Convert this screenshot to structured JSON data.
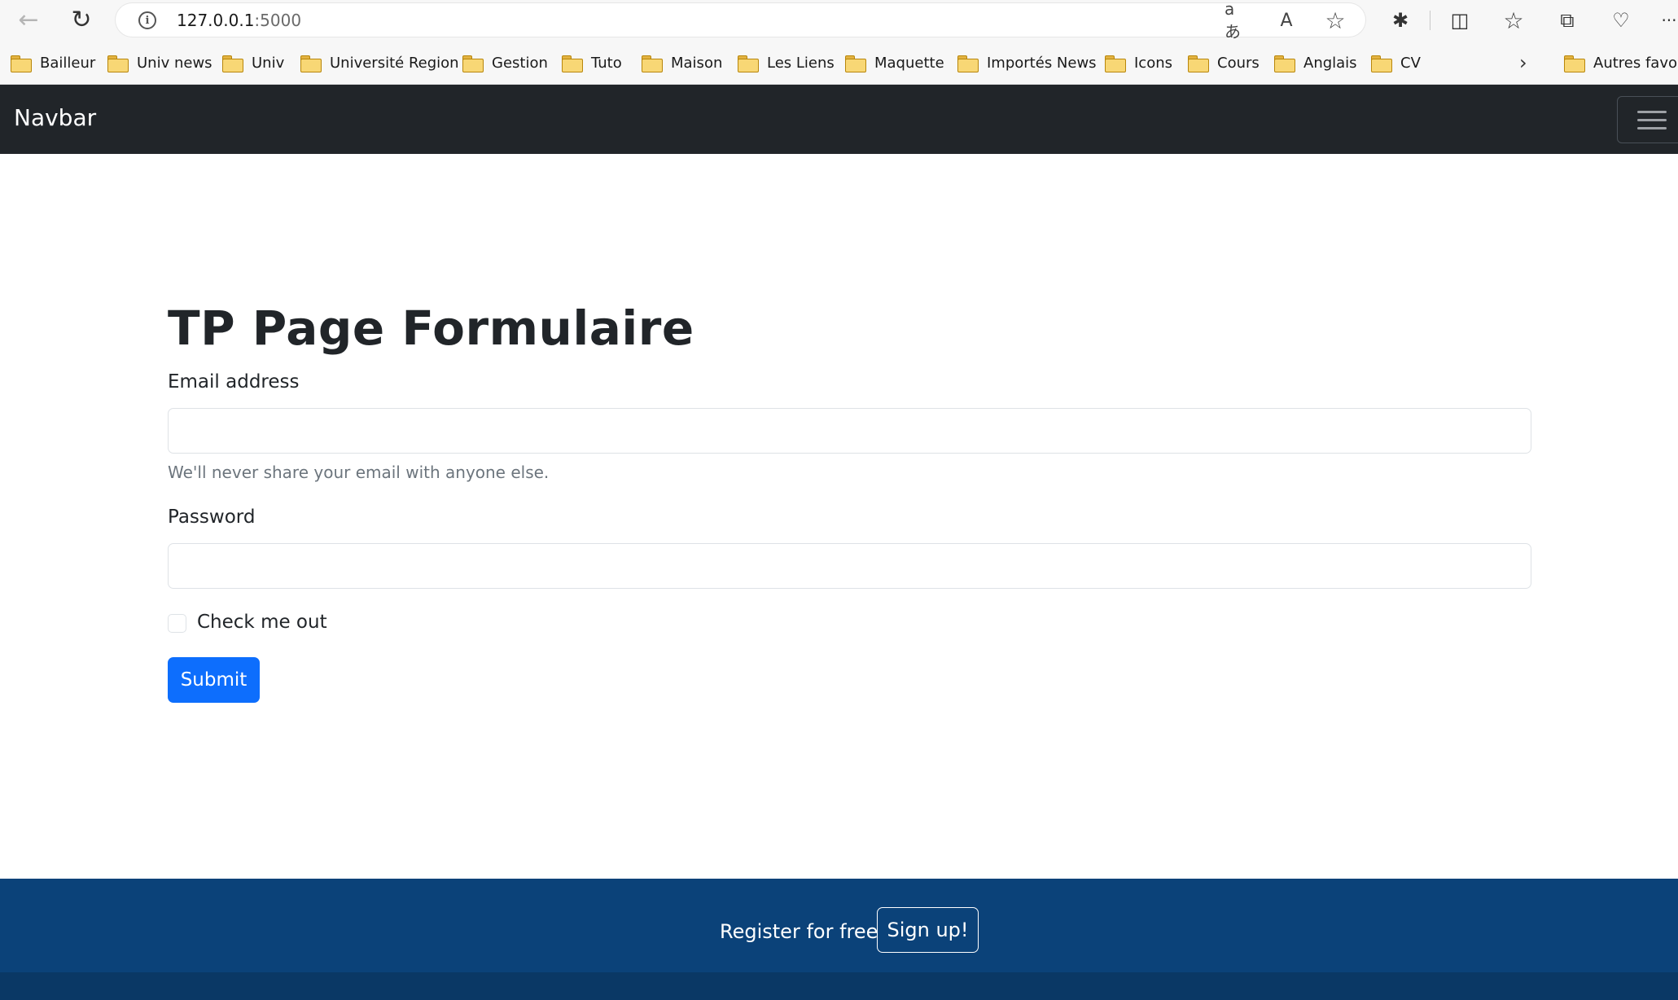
{
  "browser": {
    "url_host": "127.0.0.1",
    "url_port": ":5000",
    "icons": {
      "back": "←",
      "reload": "↻",
      "info": "i",
      "translate": "aあ",
      "read_aloud": "A",
      "favorite": "☆",
      "extensions": "✱",
      "split_screen": "◫",
      "favorites": "☆",
      "collections": "⧉",
      "health": "♡",
      "more": "···"
    }
  },
  "bookmarks": {
    "items": [
      {
        "label": "Bailleur"
      },
      {
        "label": "Univ news"
      },
      {
        "label": "Univ"
      },
      {
        "label": "Université Region"
      },
      {
        "label": "Gestion"
      },
      {
        "label": "Tuto"
      },
      {
        "label": "Maison"
      },
      {
        "label": "Les Liens"
      },
      {
        "label": "Maquette"
      },
      {
        "label": "Importés News"
      },
      {
        "label": "Icons"
      },
      {
        "label": "Cours"
      },
      {
        "label": "Anglais"
      },
      {
        "label": "CV"
      }
    ],
    "overflow": "›",
    "other": "Autres favoris"
  },
  "navbar": {
    "brand": "Navbar"
  },
  "form": {
    "title": "TP Page Formulaire",
    "email_label": "Email address",
    "email_value": "",
    "email_help": "We'll never share your email with anyone else.",
    "password_label": "Password",
    "password_value": "",
    "check_label": "Check me out",
    "submit_label": "Submit"
  },
  "footer": {
    "register_text": "Register for free",
    "signup_label": "Sign up!"
  },
  "colors": {
    "navbar_bg": "#212529",
    "primary": "#0d6efd",
    "footer_bg": "#0b4279"
  }
}
